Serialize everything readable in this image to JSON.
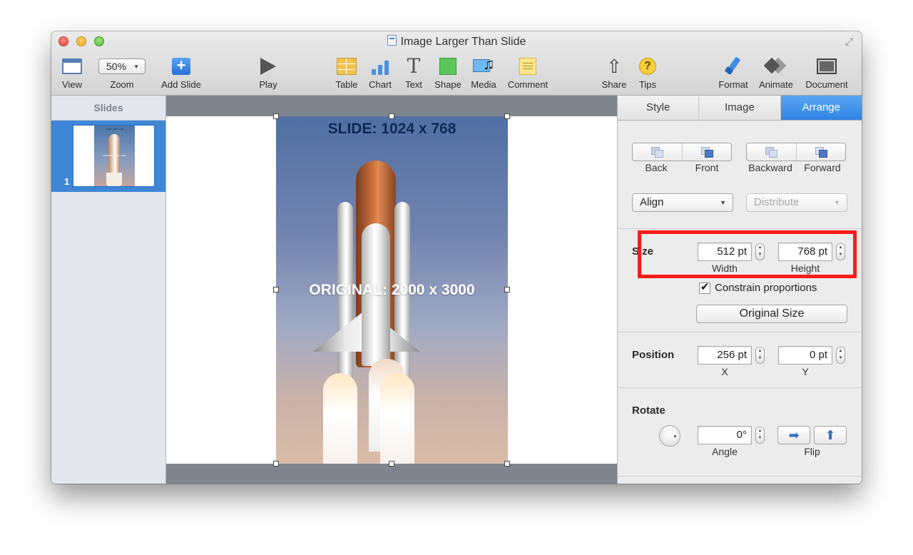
{
  "window": {
    "title": "Image Larger Than Slide"
  },
  "toolbar": {
    "view": "View",
    "zoom_value": "50%",
    "zoom": "Zoom",
    "add_slide": "Add Slide",
    "play": "Play",
    "table": "Table",
    "chart": "Chart",
    "text": "Text",
    "text_glyph": "T",
    "shape": "Shape",
    "media": "Media",
    "comment": "Comment",
    "share": "Share",
    "tips": "Tips",
    "tips_glyph": "?",
    "format": "Format",
    "animate": "Animate",
    "document": "Document"
  },
  "sidebar": {
    "header": "Slides",
    "slides": [
      {
        "number": "1",
        "title_text": "SLIDE: 1024 x 768",
        "subtitle_text": "ORIGINAL: 2000 x 3000"
      }
    ]
  },
  "slide": {
    "title_text": "SLIDE: 1024 x 768",
    "image_text": "ORIGINAL: 2000 x 3000"
  },
  "inspector": {
    "tabs": [
      "Style",
      "Image",
      "Arrange"
    ],
    "active_tab": "Arrange",
    "arrange": {
      "back": "Back",
      "front": "Front",
      "backward": "Backward",
      "forward": "Forward",
      "align": "Align",
      "distribute": "Distribute",
      "size_title": "Size",
      "width_value": "512 pt",
      "width_label": "Width",
      "height_value": "768 pt",
      "height_label": "Height",
      "constrain_label": "Constrain proportions",
      "constrain_checked": true,
      "original_size": "Original Size",
      "position_title": "Position",
      "x_value": "256 pt",
      "x_label": "X",
      "y_value": "0 pt",
      "y_label": "Y",
      "rotate_title": "Rotate",
      "angle_value": "0°",
      "angle_label": "Angle",
      "flip_label": "Flip"
    }
  },
  "colors": {
    "accent": "#2f83e3",
    "highlight": "#ff1a1a",
    "sidebar_selection": "#3f86d6"
  }
}
